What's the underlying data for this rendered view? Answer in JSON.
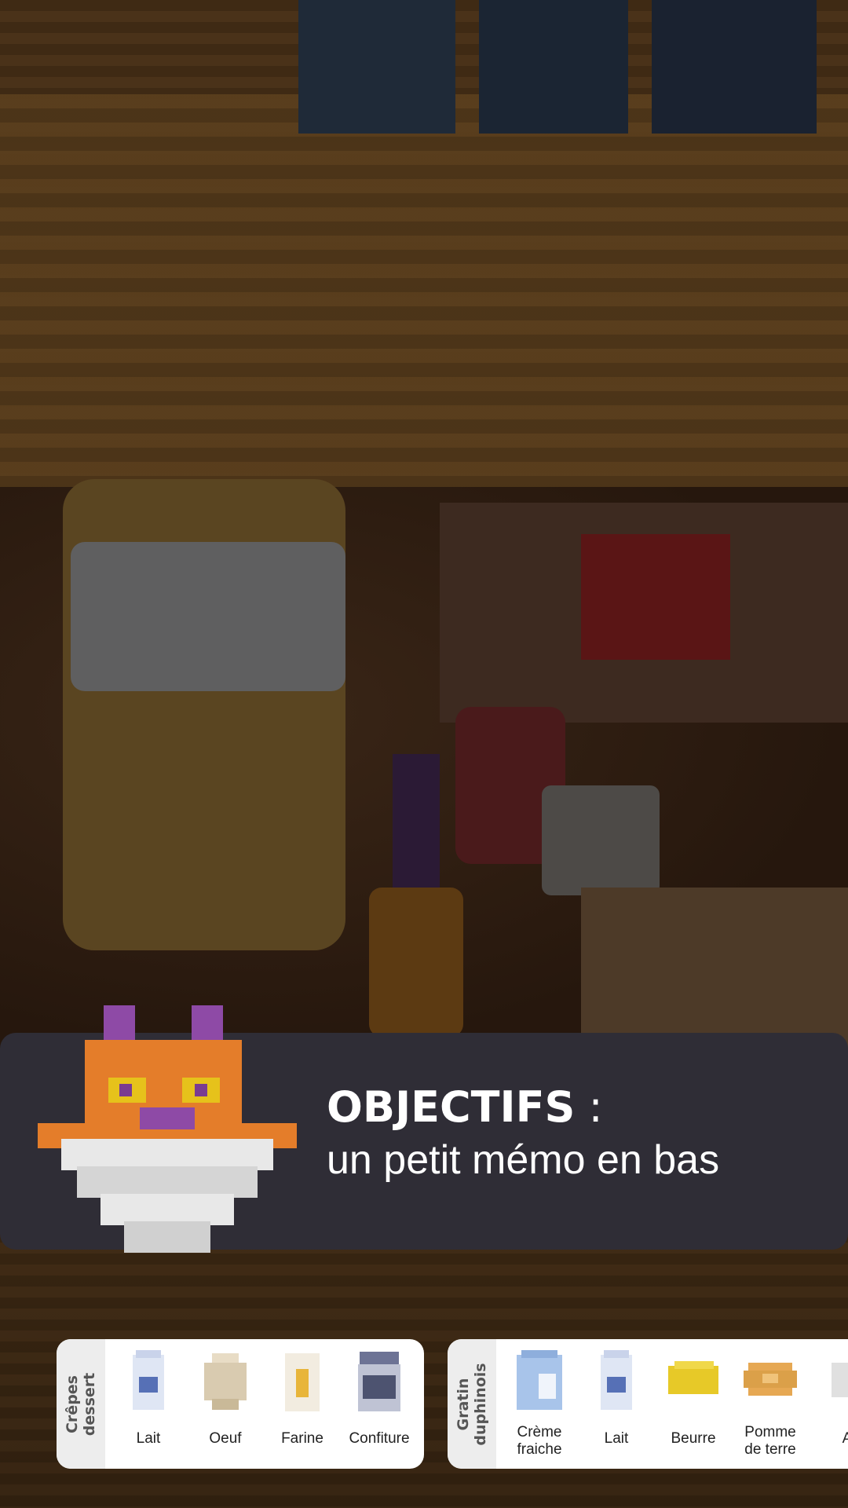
{
  "dialog": {
    "title": "OBJECTIFS",
    "separator": " :",
    "subtitle": "un petit mémo en bas"
  },
  "memo_cards": [
    {
      "recipe": "Crêpes\ndessert",
      "ingredients": [
        "Lait",
        "Oeuf",
        "Farine",
        "Confiture"
      ]
    },
    {
      "recipe": "Gratin\nduphinois",
      "ingredients": [
        "Crème\nfraiche",
        "Lait",
        "Beurre",
        "Pomme\nde terre",
        "A"
      ]
    }
  ],
  "icons": [
    "mascot-cat-icon",
    "milk-carton-icon",
    "egg-icon",
    "flour-bag-icon",
    "jam-jar-icon",
    "cream-carton-icon",
    "butter-icon",
    "potato-icon"
  ]
}
